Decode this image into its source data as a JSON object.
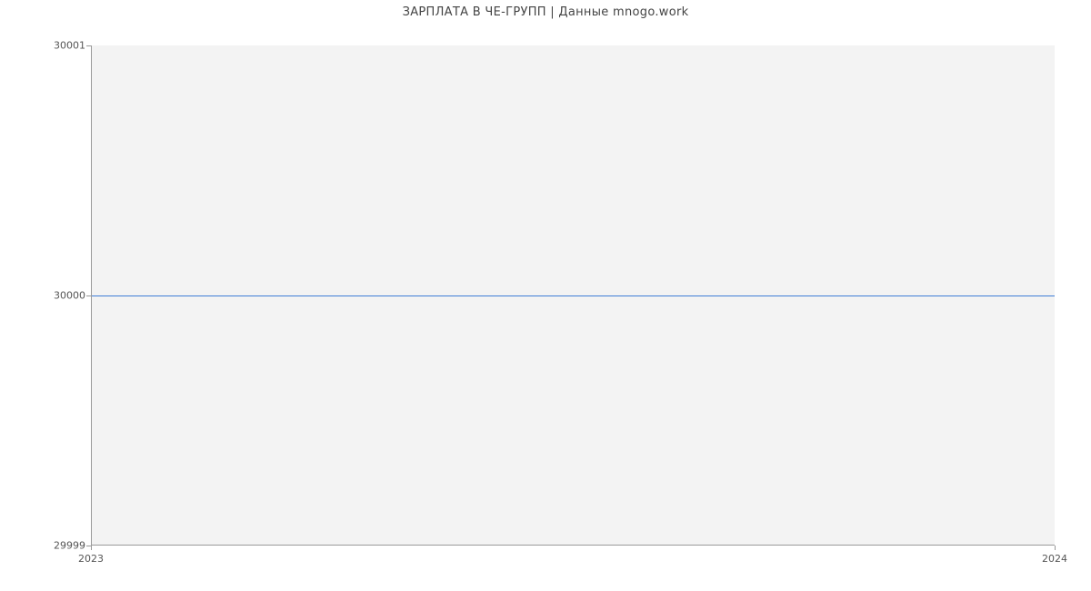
{
  "chart_data": {
    "type": "line",
    "title": "ЗАРПЛАТА В  ЧЕ-ГРУПП | Данные mnogo.work",
    "x": [
      2023,
      2024
    ],
    "values": [
      30000,
      30000
    ],
    "xlabel": "",
    "ylabel": "",
    "xlim": [
      2023,
      2024
    ],
    "ylim": [
      29999,
      30001
    ],
    "x_ticks": [
      2023,
      2024
    ],
    "y_ticks": [
      29999,
      30000,
      30001
    ],
    "series_color": "#3f7dd6",
    "plot_bg": "#f3f3f3"
  }
}
